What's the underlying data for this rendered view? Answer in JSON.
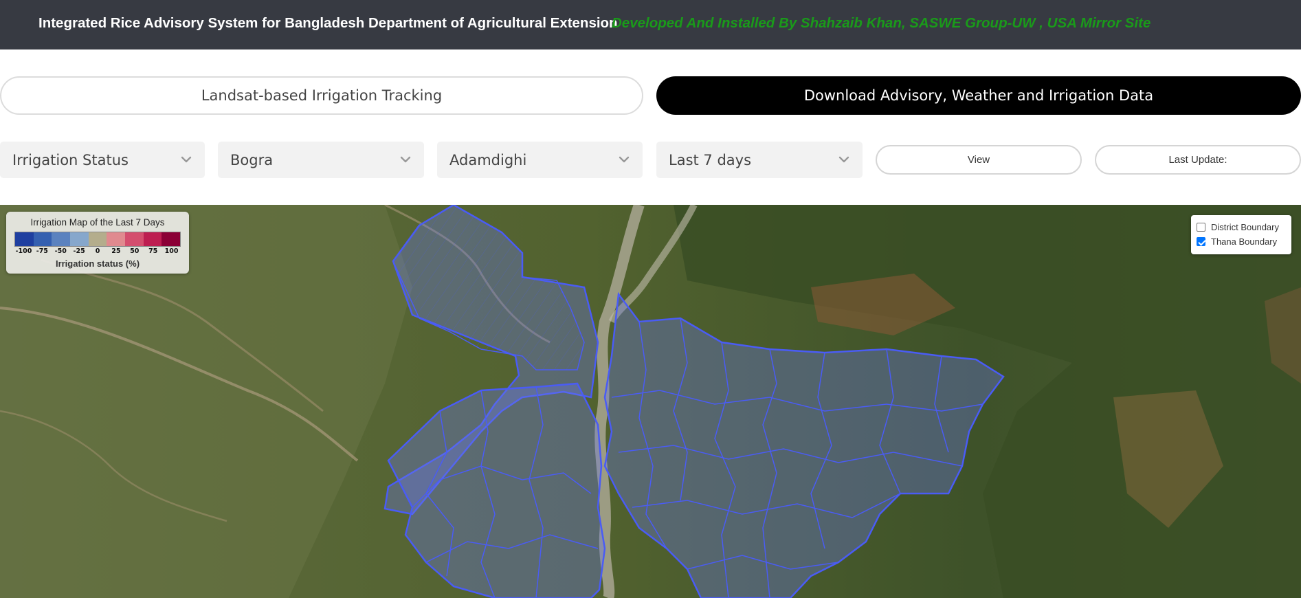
{
  "header": {
    "title": "Integrated Rice Advisory System for Bangladesh Department of Agricultural Extension",
    "credit": "Developed And Installed By Shahzaib Khan, SASWE Group-UW , USA Mirror Site",
    "credit_color": "#1a9a1a",
    "background": "#373a42"
  },
  "tabs": {
    "irrigation_tracking": "Landsat-based Irrigation Tracking",
    "download": "Download Advisory, Weather and Irrigation Data"
  },
  "filters": {
    "parameter": "Irrigation Status",
    "district": "Bogra",
    "thana": "Adamdighi",
    "period": "Last 7 days",
    "chevron_icon": "chevron-down-icon"
  },
  "actions": {
    "view": "View",
    "last_update": "Last Update:"
  },
  "legend": {
    "title": "Irrigation Map of the Last 7 Days",
    "unit": "Irrigation status (%)",
    "ticks": [
      "-100",
      "-75",
      "-50",
      "-25",
      "0",
      "25",
      "50",
      "75",
      "100"
    ],
    "colors": [
      "#1f3fa0",
      "#3560b0",
      "#5b82bf",
      "#86a7cc",
      "#b4ad8c",
      "#e08a8f",
      "#d44e6e",
      "#bd1e51",
      "#8b0036"
    ]
  },
  "layers": {
    "district_boundary": {
      "label": "District Boundary",
      "checked": false
    },
    "thana_boundary": {
      "label": "Thana Boundary",
      "checked": true
    }
  },
  "map": {
    "boundary_color": "#4a5cf5",
    "boundary_fill": "#6b78e8"
  }
}
